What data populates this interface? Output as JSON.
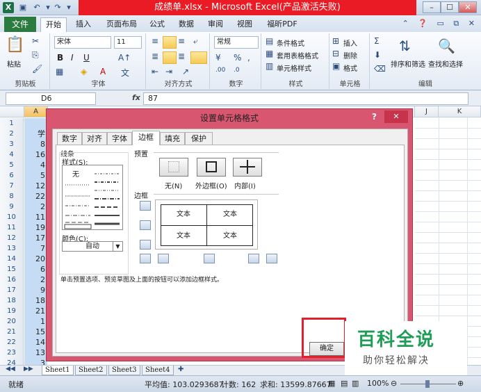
{
  "window": {
    "title": "成绩单.xlsx - Microsoft Excel(产品激活失败)",
    "min": "–",
    "max": "☐",
    "close": "✕"
  },
  "ribbon_tabs": [
    "文件",
    "开始",
    "插入",
    "页面布局",
    "公式",
    "数据",
    "审阅",
    "视图",
    "福昕PDF"
  ],
  "ribbon": {
    "clipboard": {
      "paste": "粘贴",
      "label": "剪贴板"
    },
    "font": {
      "name": "宋体",
      "size": "11",
      "bold": "B",
      "italic": "I",
      "underline": "U",
      "label": "字体"
    },
    "alignment": {
      "label": "对齐方式"
    },
    "number": {
      "format": "常规",
      "label": "数字"
    },
    "styles": {
      "conditional": "条件格式",
      "table": "套用表格格式",
      "cell": "单元格样式",
      "label": "样式"
    },
    "cells": {
      "insert": "插入",
      "delete": "删除",
      "format": "格式",
      "label": "单元格"
    },
    "editing": {
      "sort": "排序和筛选",
      "find": "查找和选择",
      "label": "编辑"
    }
  },
  "formula_bar": {
    "cell": "D6",
    "fx": "fx",
    "value": "87"
  },
  "columns": [
    "A",
    "J",
    "K"
  ],
  "column_a_header": "学号",
  "rows": [
    {
      "n": "1",
      "a": ""
    },
    {
      "n": "2",
      "a": "学"
    },
    {
      "n": "3",
      "a": "8"
    },
    {
      "n": "4",
      "a": "16"
    },
    {
      "n": "5",
      "a": "4"
    },
    {
      "n": "6",
      "a": "5"
    },
    {
      "n": "7",
      "a": "12"
    },
    {
      "n": "8",
      "a": "22"
    },
    {
      "n": "9",
      "a": "2"
    },
    {
      "n": "10",
      "a": "11"
    },
    {
      "n": "11",
      "a": "19"
    },
    {
      "n": "12",
      "a": "17"
    },
    {
      "n": "13",
      "a": "7"
    },
    {
      "n": "14",
      "a": "20"
    },
    {
      "n": "15",
      "a": "6"
    },
    {
      "n": "16",
      "a": "2"
    },
    {
      "n": "17",
      "a": "9"
    },
    {
      "n": "18",
      "a": "18"
    },
    {
      "n": "19",
      "a": "21"
    },
    {
      "n": "20",
      "a": "1"
    },
    {
      "n": "21",
      "a": "15"
    },
    {
      "n": "22",
      "a": "14"
    },
    {
      "n": "23",
      "a": "13"
    },
    {
      "n": "24",
      "a": "3"
    }
  ],
  "sheets": [
    "Sheet1",
    "Sheet2",
    "Sheet3",
    "Sheet4"
  ],
  "status": {
    "mode": "就绪",
    "average": "平均值: 103.0293687",
    "count": "计数: 162",
    "sum": "求和: 13599.87667",
    "zoom": "100%"
  },
  "dialog": {
    "title": "设置单元格格式",
    "help": "?",
    "close": "✕",
    "tabs": [
      "数字",
      "对齐",
      "字体",
      "边框",
      "填充",
      "保护"
    ],
    "active_tab": "边框",
    "line_group": "线条",
    "style_label": "样式(S):",
    "style_none": "无",
    "color_label": "颜色(C):",
    "color_value": "自动",
    "presets_label": "预置",
    "preset_none": "无(N)",
    "preset_outline": "外边框(O)",
    "preset_inside": "内部(I)",
    "border_label": "边框",
    "preview_text": "文本",
    "description": "单击预置选项、预览草图及上面的按钮可以添加边框样式。",
    "ok": "确定"
  },
  "watermark": {
    "title": "百科全说",
    "subtitle": "助你轻松解决"
  }
}
